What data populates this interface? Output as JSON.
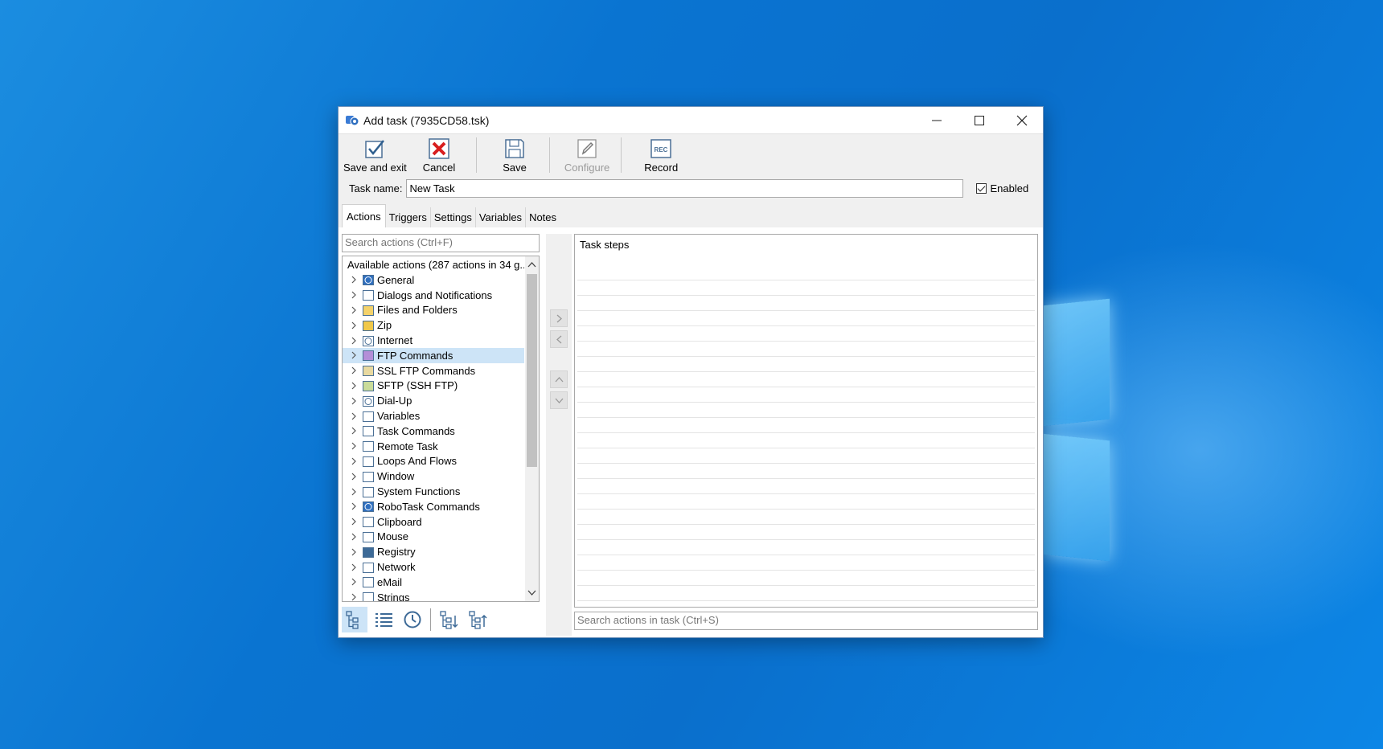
{
  "window": {
    "title": "Add task (7935CD58.tsk)",
    "controls": [
      "minimize",
      "maximize",
      "close"
    ]
  },
  "toolbar": {
    "buttons": [
      {
        "label": "Save and exit",
        "icon": "check-icon",
        "enabled": true
      },
      {
        "label": "Cancel",
        "icon": "cancel-icon",
        "enabled": true
      },
      {
        "label": "Save",
        "icon": "floppy-icon",
        "enabled": true
      },
      {
        "label": "Configure",
        "icon": "pencil-icon",
        "enabled": false
      },
      {
        "label": "Record",
        "icon": "record-icon",
        "enabled": true
      }
    ]
  },
  "task_name": {
    "label": "Task name:",
    "value": "New Task"
  },
  "enabled": {
    "label": "Enabled",
    "checked": true
  },
  "tabs": [
    {
      "label": "Actions",
      "active": true
    },
    {
      "label": "Triggers",
      "active": false
    },
    {
      "label": "Settings",
      "active": false
    },
    {
      "label": "Variables",
      "active": false
    },
    {
      "label": "Notes",
      "active": false
    }
  ],
  "actions_search": {
    "placeholder": "Search actions (Ctrl+F)"
  },
  "actions_tree": {
    "header": "Available actions (287 actions in 34 g...",
    "items": [
      {
        "label": "General",
        "icon": "robotask-icon"
      },
      {
        "label": "Dialogs and Notifications",
        "icon": "dialog-icon"
      },
      {
        "label": "Files and Folders",
        "icon": "folder-icon"
      },
      {
        "label": "Zip",
        "icon": "zip-icon"
      },
      {
        "label": "Internet",
        "icon": "globe-icon"
      },
      {
        "label": "FTP Commands",
        "icon": "ftp-icon",
        "selected": true
      },
      {
        "label": "SSL FTP Commands",
        "icon": "ssl-ftp-icon"
      },
      {
        "label": "SFTP (SSH FTP)",
        "icon": "sftp-icon"
      },
      {
        "label": "Dial-Up",
        "icon": "dialup-icon"
      },
      {
        "label": "Variables",
        "icon": "variables-icon"
      },
      {
        "label": "Task Commands",
        "icon": "task-icon"
      },
      {
        "label": "Remote Task",
        "icon": "remote-task-icon"
      },
      {
        "label": "Loops And Flows",
        "icon": "loops-icon"
      },
      {
        "label": "Window",
        "icon": "window-icon"
      },
      {
        "label": "System Functions",
        "icon": "system-icon"
      },
      {
        "label": "RoboTask Commands",
        "icon": "robotask-icon"
      },
      {
        "label": "Clipboard",
        "icon": "clipboard-icon"
      },
      {
        "label": "Mouse",
        "icon": "mouse-icon"
      },
      {
        "label": "Registry",
        "icon": "registry-icon"
      },
      {
        "label": "Network",
        "icon": "network-icon"
      },
      {
        "label": "eMail",
        "icon": "email-icon"
      },
      {
        "label": "Strings",
        "icon": "strings-icon"
      }
    ]
  },
  "steps": {
    "title": "Task steps"
  },
  "steps_search": {
    "placeholder": "Search actions in task (Ctrl+S)"
  },
  "colors": {
    "selection": "#cde4f7",
    "desktop": "#0a74d1"
  }
}
